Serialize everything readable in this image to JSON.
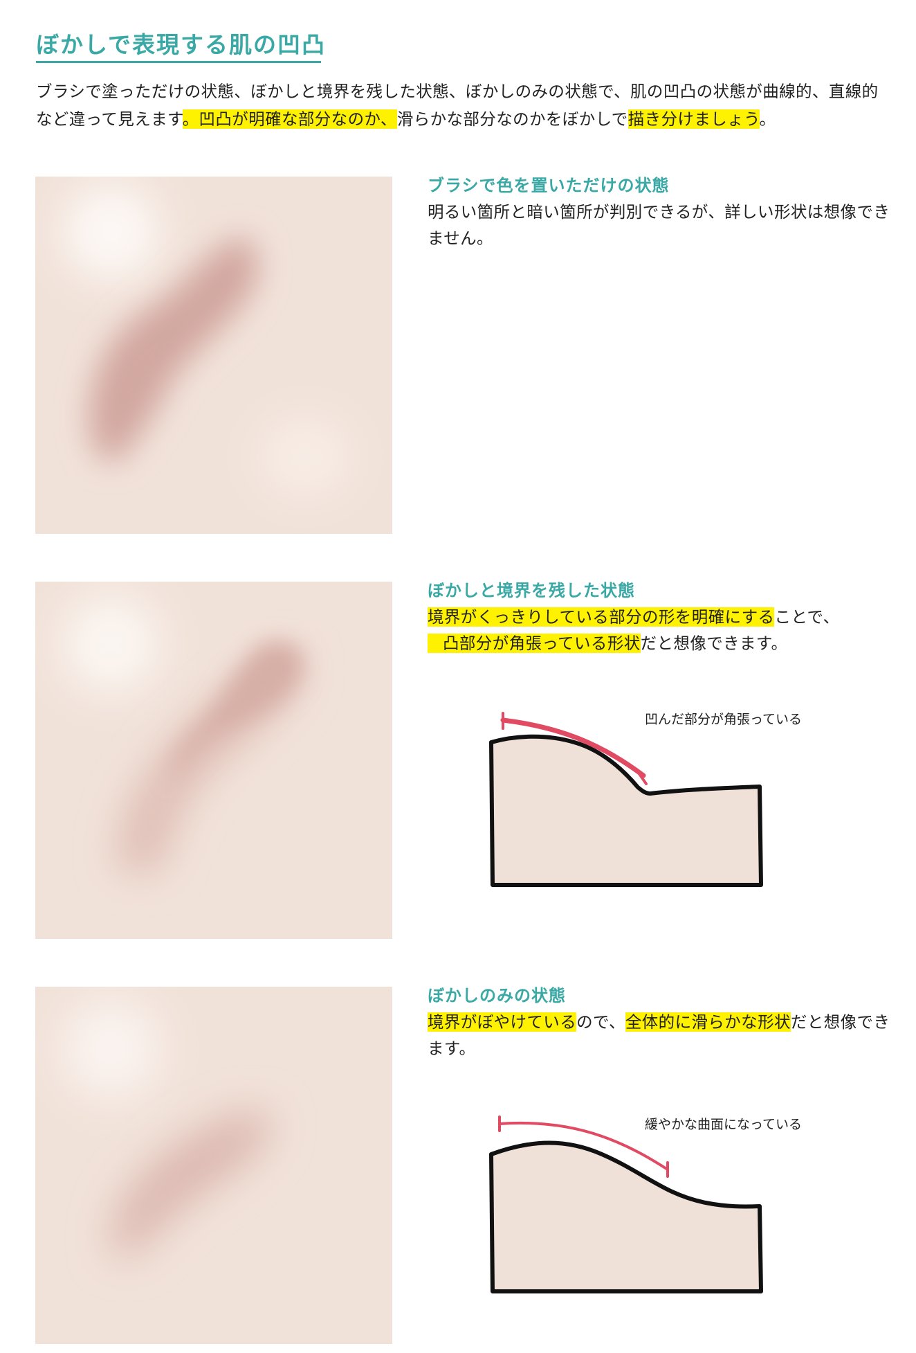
{
  "title": "ぼかしで表現する肌の凹凸",
  "intro": {
    "text1": "ブラシで塗っただけの状態、ぼかしと境界を残した状態、ぼかしのみの状態で、肌の凹凸の状態が曲線的、直線的など違って見えます",
    "hl1": "。凹凸が明確な部分なのか、",
    "text2": "滑らかな部分なのかをぼかしで",
    "hl2": "描き分けましょう",
    "text3": "。"
  },
  "sections": [
    {
      "heading": "ブラシで色を置いただけの状態",
      "body": "明るい箇所と暗い箇所が判別できるが、詳しい形状は想像できません。"
    },
    {
      "heading": "ぼかしと境界を残した状態",
      "hl1": "境界がくっきりしている部分の形を明確にする",
      "text1": "ことで、",
      "hl2": "凸部分が角張っている形状",
      "text2": "だと想像できます。",
      "diagram_label": "凹んだ部分が角張っている"
    },
    {
      "heading": "ぼかしのみの状態",
      "hl1": "境界がぼやけている",
      "text1": "ので、",
      "hl2": "全体的に滑らかな形状",
      "text2": "だと想像できます。",
      "diagram_label": "緩やかな曲面になっている"
    }
  ],
  "colors": {
    "accent": "#3aa9a6",
    "highlight": "#fff200",
    "skin": "#f1e2d9",
    "shadow": "#cfa39c",
    "marker": "#e04a62"
  }
}
